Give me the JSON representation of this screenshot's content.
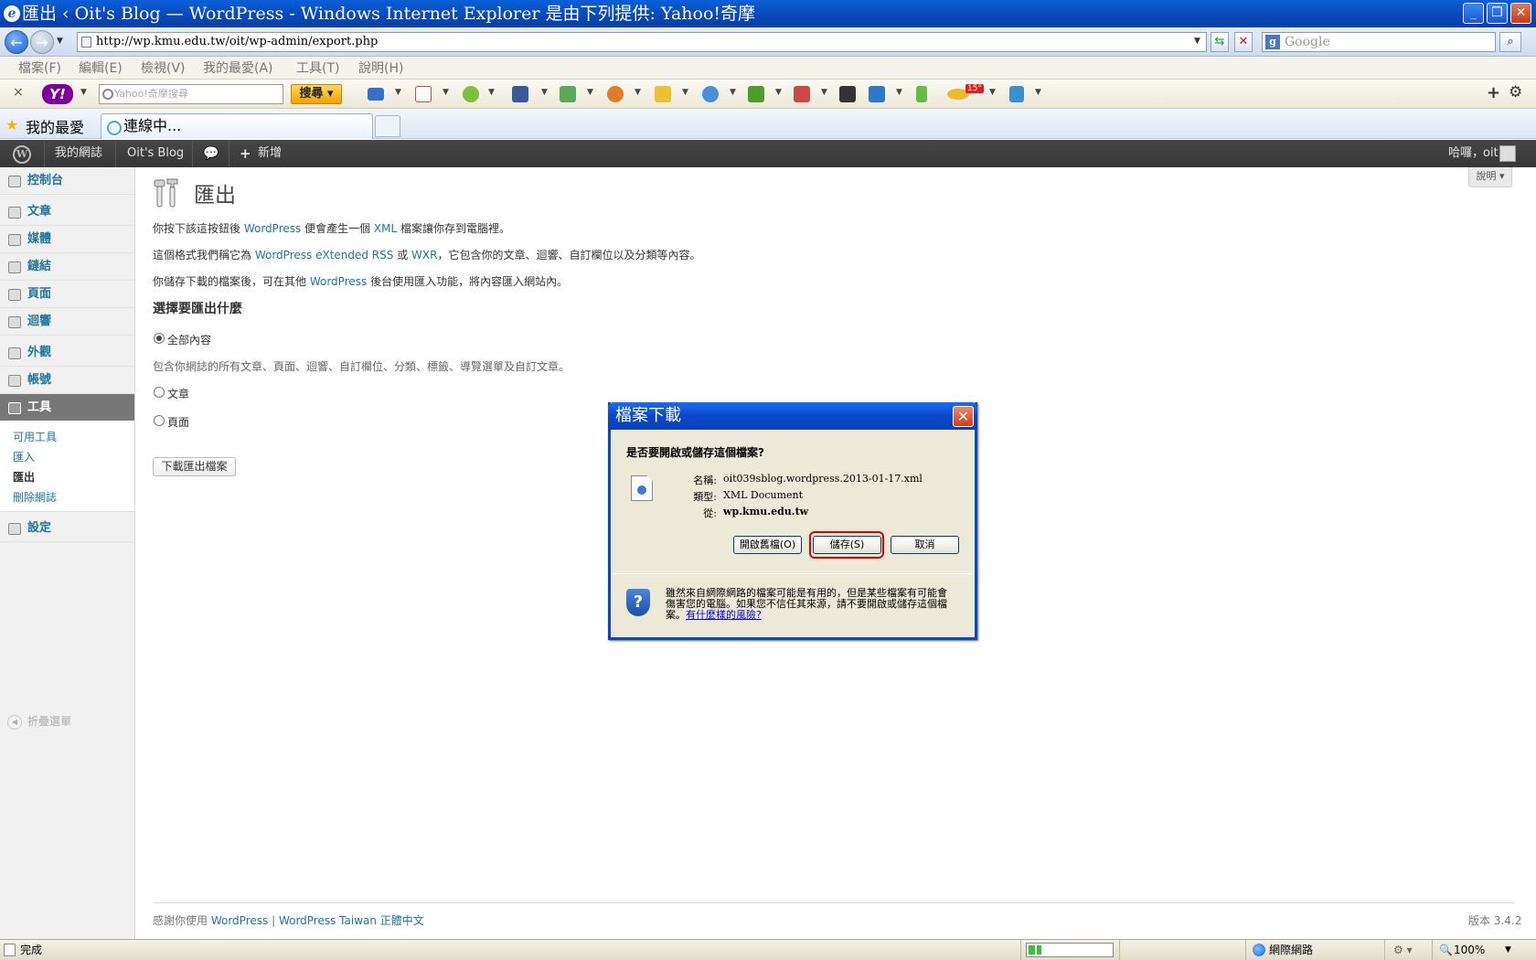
{
  "browser": {
    "window_title": "匯出 ‹ Oit's Blog — WordPress - Windows Internet Explorer 是由下列提供: Yahoo!奇摩",
    "address": "http://wp.kmu.edu.tw/oit/wp-admin/export.php",
    "search_placeholder": "Google",
    "menu": [
      "檔案(F)",
      "編輯(E)",
      "檢視(V)",
      "我的最愛(A)",
      "工具(T)",
      "說明(H)"
    ],
    "yahoo": {
      "close": "×",
      "logo": "Y!",
      "search_placeholder": "Yahoo!奇摩搜尋",
      "search_button": "搜尋",
      "weather": "15°"
    },
    "favorites_label": "我的最愛",
    "tab_title": "連線中..."
  },
  "wp": {
    "adminbar": {
      "my_sites": "我的網誌",
      "site_name": "Oit's Blog",
      "new": "新增",
      "greeting": "哈囉，",
      "user": "oit"
    },
    "sidebar": {
      "items": [
        {
          "label": "控制台",
          "icon": "dashboard-icon"
        },
        {
          "label": "文章",
          "icon": "pin-icon"
        },
        {
          "label": "媒體",
          "icon": "media-icon"
        },
        {
          "label": "鏈結",
          "icon": "link-icon"
        },
        {
          "label": "頁面",
          "icon": "page-icon"
        },
        {
          "label": "迴響",
          "icon": "comment-icon"
        },
        {
          "label": "外觀",
          "icon": "appearance-icon"
        },
        {
          "label": "帳號",
          "icon": "users-icon"
        },
        {
          "label": "工具",
          "icon": "tools-icon"
        },
        {
          "label": "設定",
          "icon": "settings-icon"
        }
      ],
      "submenu": [
        "可用工具",
        "匯入",
        "匯出",
        "刪除網誌"
      ],
      "collapse": "折疊選單"
    },
    "help": "說明",
    "page_title": "匯出",
    "intro": {
      "p1_pre": "你按下該這按鈕後 ",
      "p1_link1": "WordPress",
      "p1_mid": " 便會產生一個 ",
      "p1_link2": "XML",
      "p1_post": " 檔案讓你存到電腦裡。",
      "p2_pre": "這個格式我們稱它為 ",
      "p2_link1": "WordPress eXtended RSS",
      "p2_mid": " 或 ",
      "p2_link2": "WXR",
      "p2_post": "，它包含你的文章、迴響、自訂欄位以及分類等內容。",
      "p3_pre": "你儲存下載的檔案後，可在其他 ",
      "p3_link": "WordPress",
      "p3_post": " 後台使用匯入功能，將內容匯入網站內。"
    },
    "choose_heading": "選擇要匯出什麼",
    "options": [
      {
        "label": "全部內容",
        "checked": true
      },
      {
        "label": "文章",
        "checked": false
      },
      {
        "label": "頁面",
        "checked": false
      }
    ],
    "all_description": "包含你網誌的所有文章、頁面、迴響、自訂欄位、分類、標籤、導覽選單及自訂文章。",
    "download_button": "下載匯出檔案",
    "footer": {
      "thanks": "感謝你使用 ",
      "link1": "WordPress",
      "sep": " | ",
      "link2": "WordPress Taiwan 正體中文",
      "version": "版本 3.4.2"
    }
  },
  "dialog": {
    "title": "檔案下載",
    "question": "是否要開啟或儲存這個檔案?",
    "fields": [
      {
        "key": "名稱:",
        "value": "oit039sblog.wordpress.2013-01-17.xml"
      },
      {
        "key": "類型:",
        "value": "XML Document"
      },
      {
        "key": "從:",
        "value": "wp.kmu.edu.tw"
      }
    ],
    "buttons": {
      "open": "開啟舊檔(O)",
      "save": "儲存(S)",
      "cancel": "取消"
    },
    "warning": "雖然來自網際網路的檔案可能是有用的，但是某些檔案有可能會傷害您的電腦。如果您不信任其來源，請不要開啟或儲存這個檔案。",
    "risk_link": "有什麼樣的風險?"
  },
  "status": {
    "text": "完成",
    "progress": 0.15,
    "zone": "網際網路",
    "zoom": "100%"
  },
  "colors": {
    "xp_blue": "#0a47c8",
    "wp_link": "#21759b",
    "adminbar": "#464646",
    "highlight": "#e00000"
  }
}
